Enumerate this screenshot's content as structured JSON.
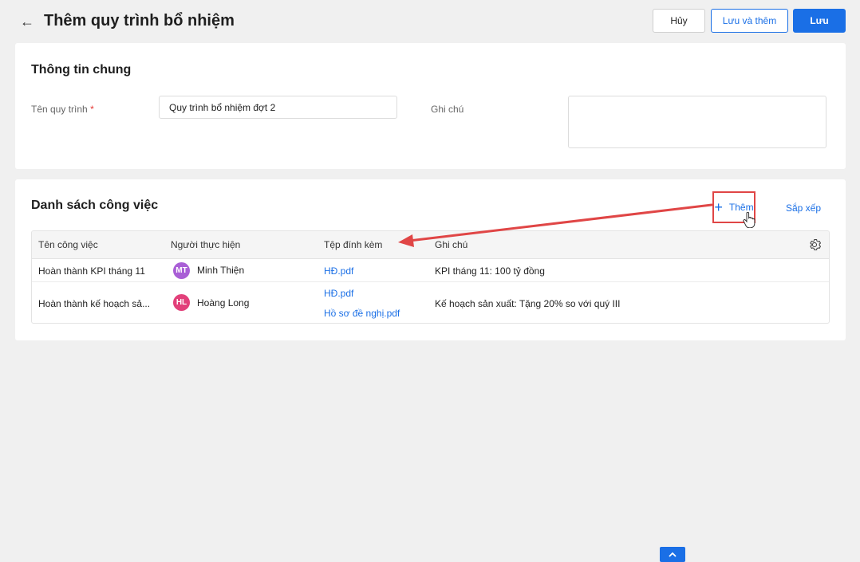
{
  "header": {
    "title": "Thêm quy trình bổ nhiệm",
    "cancel_label": "Hủy",
    "save_add_label": "Lưu và thêm",
    "save_label": "Lưu"
  },
  "general": {
    "title": "Thông tin chung",
    "name_label": "Tên quy trình",
    "required_mark": "*",
    "name_value": "Quy trình bổ nhiệm đợt 2",
    "note_label": "Ghi chú",
    "note_value": ""
  },
  "tasks": {
    "title": "Danh sách công việc",
    "add_label": "Thêm",
    "sort_label": "Sắp xếp",
    "columns": [
      "Tên công việc",
      "Người thực hiện",
      "Tệp đính kèm",
      "Ghi chú"
    ],
    "rows": [
      {
        "name": "Hoàn thành KPI tháng 11",
        "assignee_initials": "MT",
        "assignee": "Minh Thiện",
        "attachments": [
          "HĐ.pdf"
        ],
        "note": "KPI tháng 11: 100 tỷ đồng"
      },
      {
        "name": "Hoàn thành kế hoạch sả...",
        "assignee_initials": "HL",
        "assignee": "Hoàng Long",
        "attachments": [
          "HĐ.pdf",
          "Hồ sơ đề nghị.pdf"
        ],
        "note": "Kế hoạch sản xuất: Tặng 20% so với quý III"
      }
    ]
  },
  "colors": {
    "accent": "#1a6fe6",
    "highlight": "#e04646",
    "avatar_mt": "#a95fd6",
    "avatar_hl": "#e2407a"
  },
  "icons": [
    "back-arrow-icon",
    "plus-icon",
    "hand-cursor-icon",
    "gear-icon",
    "chevron-up-icon"
  ]
}
